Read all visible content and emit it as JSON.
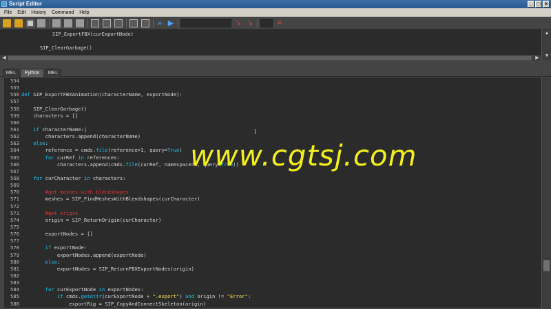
{
  "window": {
    "title": "Script Editor",
    "controls": {
      "minimize": "_",
      "maximize": "□",
      "close": "×"
    }
  },
  "menu": [
    "File",
    "Edit",
    "History",
    "Command",
    "Help"
  ],
  "toolbar": {
    "icons": [
      "open-script-icon",
      "source-script-icon",
      "save-script-icon",
      "save-to-shelf-icon",
      "clear-history-icon",
      "clear-input-icon",
      "clear-all-icon",
      "show-history-icon",
      "show-input-icon",
      "show-both-icon",
      "echo-all-commands-icon",
      "line-numbers-icon",
      "execute-all-icon",
      "execute-icon",
      "search-input",
      "search-next-icon",
      "search-prev-icon",
      "goto-line-icon"
    ]
  },
  "history": {
    "lines": [
      "SIP_ExportFBX(curExportNode)",
      "SIP_ClearGarbage()"
    ]
  },
  "tabs": [
    {
      "label": "MEL",
      "active": false
    },
    {
      "label": "Python",
      "active": true
    },
    {
      "label": "MEL",
      "active": false
    }
  ],
  "editor": {
    "line_numbers": [
      "554",
      "555",
      "556",
      "557",
      "558",
      "559",
      "560",
      "561",
      "562",
      "563",
      "564",
      "565",
      "566",
      "567",
      "568",
      "569",
      "570",
      "571",
      "572",
      "573",
      "574",
      "575",
      "576",
      "577",
      "578",
      "579",
      "580",
      "581",
      "582",
      "583",
      "584",
      "585",
      "586"
    ],
    "lines": [
      [
        {
          "t": ""
        }
      ],
      [
        {
          "t": ""
        }
      ],
      [
        {
          "c": "kw",
          "t": "def"
        },
        {
          "t": " SIP_ExportFBXAnimation(characterName, exportNode):"
        }
      ],
      [
        {
          "t": ""
        }
      ],
      [
        {
          "t": "    SIP_ClearGarbage()"
        }
      ],
      [
        {
          "t": "    characters = []"
        }
      ],
      [
        {
          "t": ""
        }
      ],
      [
        {
          "t": "    "
        },
        {
          "c": "kw",
          "t": "if"
        },
        {
          "t": " characterName:|"
        }
      ],
      [
        {
          "t": "        characters.append(characterName)"
        }
      ],
      [
        {
          "t": "    "
        },
        {
          "c": "kw",
          "t": "else"
        },
        {
          "t": ":"
        }
      ],
      [
        {
          "t": "        reference = cmds."
        },
        {
          "c": "kw",
          "t": "file"
        },
        {
          "t": "(reference=1, query="
        },
        {
          "c": "kw",
          "t": "True"
        },
        {
          "t": ")"
        }
      ],
      [
        {
          "t": "        "
        },
        {
          "c": "kw",
          "t": "for"
        },
        {
          "t": " curRef "
        },
        {
          "c": "kw",
          "t": "in"
        },
        {
          "t": " references:"
        }
      ],
      [
        {
          "t": "            characters.append(cmds."
        },
        {
          "c": "kw",
          "t": "file"
        },
        {
          "t": "(curRef, namespace=1, query="
        },
        {
          "c": "kw",
          "t": "True"
        },
        {
          "t": "))"
        }
      ],
      [
        {
          "t": ""
        }
      ],
      [
        {
          "t": "    "
        },
        {
          "c": "kw",
          "t": "for"
        },
        {
          "t": " curCharacter "
        },
        {
          "c": "kw",
          "t": "in"
        },
        {
          "t": " characters:"
        }
      ],
      [
        {
          "t": ""
        }
      ],
      [
        {
          "t": "        "
        },
        {
          "c": "cm",
          "t": "#get meshes with blendshapes"
        }
      ],
      [
        {
          "t": "        meshes = SIP_FindMeshesWithBlendshapes(curCharacter)"
        }
      ],
      [
        {
          "t": ""
        }
      ],
      [
        {
          "t": "        "
        },
        {
          "c": "cm",
          "t": "#get origin"
        }
      ],
      [
        {
          "t": "        origin = SIP_ReturnOrigin(curCharacter)"
        }
      ],
      [
        {
          "t": ""
        }
      ],
      [
        {
          "t": "        exportNodes = []"
        }
      ],
      [
        {
          "t": ""
        }
      ],
      [
        {
          "t": "        "
        },
        {
          "c": "kw",
          "t": "if"
        },
        {
          "t": " exportNode:"
        }
      ],
      [
        {
          "t": "            exportNodes.append(exportNode)"
        }
      ],
      [
        {
          "t": "        "
        },
        {
          "c": "kw",
          "t": "else"
        },
        {
          "t": ":"
        }
      ],
      [
        {
          "t": "            exportNodes = SIP_ReturnFBXExportNodes(origin)"
        }
      ],
      [
        {
          "t": ""
        }
      ],
      [
        {
          "t": ""
        }
      ],
      [
        {
          "t": "        "
        },
        {
          "c": "kw",
          "t": "for"
        },
        {
          "t": " curExportNode "
        },
        {
          "c": "kw",
          "t": "in"
        },
        {
          "t": " exportNodes:"
        }
      ],
      [
        {
          "t": "            "
        },
        {
          "c": "kw",
          "t": "if"
        },
        {
          "t": " cmds."
        },
        {
          "c": "kw",
          "t": "getAttr"
        },
        {
          "t": "(curExportNode + "
        },
        {
          "c": "str",
          "t": "\".export\""
        },
        {
          "t": ") "
        },
        {
          "c": "kw",
          "t": "and"
        },
        {
          "t": " origin != "
        },
        {
          "c": "str",
          "t": "\"Error\""
        },
        {
          "t": ":"
        }
      ],
      [
        {
          "t": "                exportRig = SIP_CopyAndConnectSkeleton(origin)"
        }
      ]
    ]
  },
  "watermark": "www.cgtsj.com",
  "colors": {
    "keyword": "#18c8ff",
    "string": "#ffe34a",
    "comment": "#e03434",
    "watermark": "#f3ef1c"
  }
}
